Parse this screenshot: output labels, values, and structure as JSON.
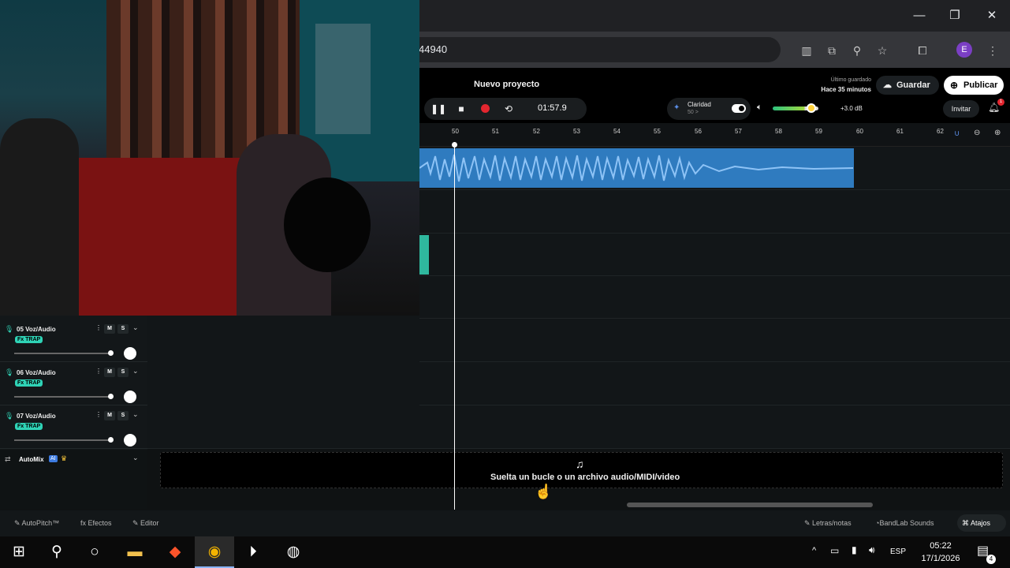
{
  "browser": {
    "url_fragment": "44940",
    "avatar_letter": "E"
  },
  "app": {
    "project_name": "Nuevo proyecto",
    "time": "01:57.9",
    "clarity_label": "Claridad",
    "clarity_value": "50 >",
    "db_label": "+3.0 dB",
    "saved_label": "Último guardado",
    "saved_time": "Hace 35 minutos",
    "save_button": "Guardar",
    "publish_button": "Publicar",
    "invite_button": "Invitar",
    "notification_count": "1"
  },
  "ruler": {
    "ticks": [
      "50",
      "51",
      "52",
      "53",
      "54",
      "55",
      "56",
      "57",
      "58",
      "59",
      "60",
      "61",
      "62"
    ]
  },
  "tracks": [
    {
      "name": "05 Voz/Audio",
      "fx": "Fx TRAP",
      "m": "M",
      "s": "S"
    },
    {
      "name": "06 Voz/Audio",
      "fx": "Fx TRAP",
      "m": "M",
      "s": "S"
    },
    {
      "name": "07 Voz/Audio",
      "fx": "Fx TRAP",
      "m": "M",
      "s": "S"
    }
  ],
  "automix": {
    "label": "AutoMix",
    "badge": "AI"
  },
  "dropzone": {
    "text": "Suelta un bucle o un archivo audio/MIDI/video"
  },
  "bottom_bar": {
    "autopitch": "AutoPitch™",
    "effects": "Efectos",
    "editor": "Editor",
    "lyrics": "Letras/notas",
    "sounds": "BandLab Sounds",
    "shortcuts": "Atajos"
  },
  "taskbar": {
    "language": "ESP",
    "time": "05:22",
    "date": "17/1/2026",
    "notifications": "4"
  },
  "colors": {
    "clip_blue": "#2f7bbf",
    "teal_accent": "#2fd3b6",
    "record_red": "#e3262f"
  }
}
